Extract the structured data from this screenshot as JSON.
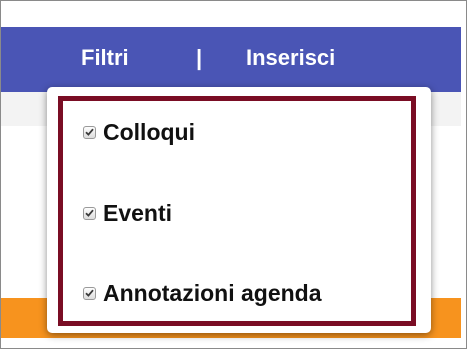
{
  "navbar": {
    "filtri_label": "Filtri",
    "separator": "|",
    "inserisci_label": "Inserisci"
  },
  "filter_menu": {
    "options": [
      {
        "label": "Colloqui",
        "checked": true
      },
      {
        "label": "Eventi",
        "checked": true
      },
      {
        "label": "Annotazioni agenda",
        "checked": true
      }
    ]
  },
  "colors": {
    "navbar": "#4a55b5",
    "highlight_border": "#7a0d24",
    "orange_band": "#f7931e"
  }
}
